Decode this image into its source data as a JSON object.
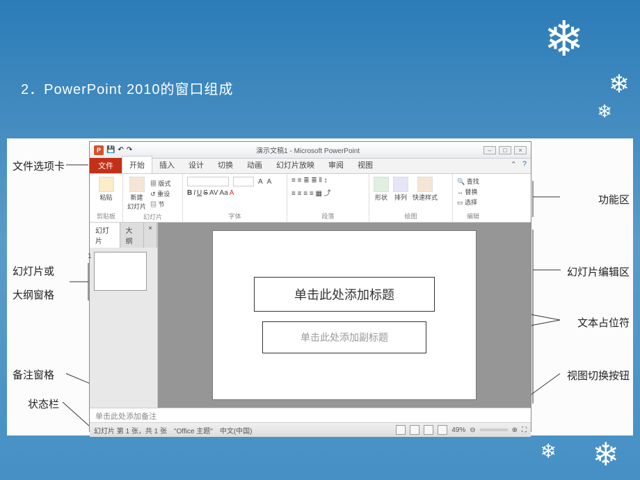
{
  "slide_title": "2．PowerPoint 2010的窗口组成",
  "labels": {
    "file_opt": "文件选项卡",
    "ribbon": "功能区",
    "slides_pane_1": "幻灯片或",
    "slides_pane_2": "大纲窗格",
    "edit_area": "幻灯片编辑区",
    "placeholder": "文本占位符",
    "notes_pane": "备注窗格",
    "view_btns": "视图切换按钮",
    "statusbar": "状态栏"
  },
  "ppt": {
    "title": "演示文稿1 - Microsoft PowerPoint",
    "tabs": {
      "file": "文件",
      "home": "开始",
      "insert": "插入",
      "design": "设计",
      "transition": "切换",
      "animation": "动画",
      "slideshow": "幻灯片放映",
      "review": "审阅",
      "view": "视图"
    },
    "ribbon_groups": {
      "clipboard": "剪贴板",
      "slides": "幻灯片",
      "font": "字体",
      "paragraph": "段落",
      "drawing": "绘图",
      "editing": "编辑"
    },
    "ribbon_items": {
      "paste": "粘贴",
      "new_slide": "新建\n幻灯片",
      "layout": "版式",
      "reset": "重设",
      "section": "节",
      "shapes": "形状",
      "arrange": "排列",
      "quickstyle": "快速样式",
      "find": "查找",
      "replace": "替换",
      "select": "选择"
    },
    "left_tabs": {
      "slides": "幻灯片",
      "outline": "大纲"
    },
    "title_ph": "单击此处添加标题",
    "subtitle_ph": "单击此处添加副标题",
    "notes_ph": "单击此处添加备注",
    "status": {
      "slide": "幻灯片 第 1 张，共 1 张",
      "theme": "\"Office 主题\"",
      "lang": "中文(中国)",
      "zoom": "49%"
    }
  }
}
